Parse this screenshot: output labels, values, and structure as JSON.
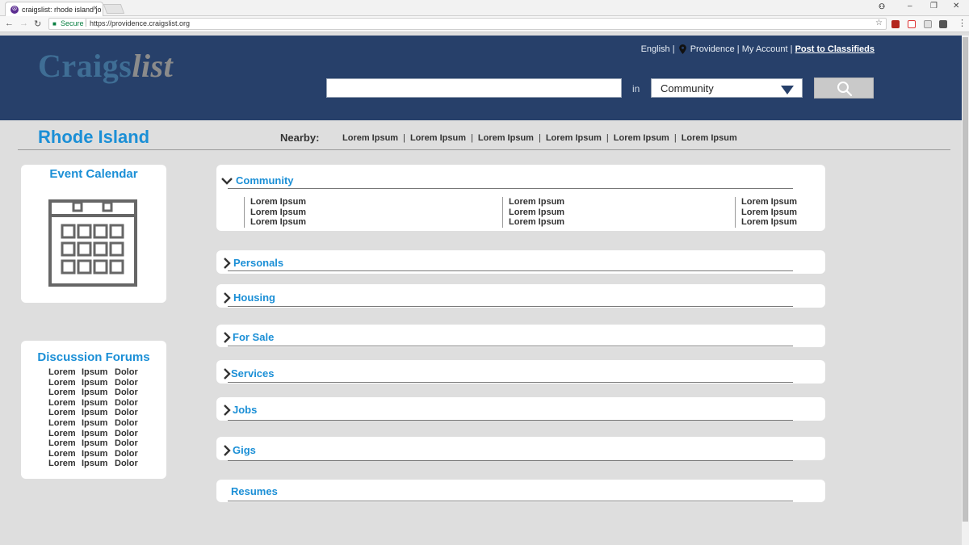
{
  "browser": {
    "tab_title": "craigslist: rhode island jo",
    "secure_label": "Secure",
    "url": "https://providence.craigslist.org"
  },
  "header": {
    "logo_main": "Craigs",
    "logo_accent": "list",
    "lang": "English |",
    "city": "Providence |",
    "account": "My Account |",
    "post": "Post to Classifieds",
    "search_value": "",
    "in_label": "in",
    "category_value": "Community"
  },
  "region": {
    "name": "Rhode Island",
    "nearby_label": "Nearby:",
    "nearby": [
      "Lorem Ipsum",
      "Lorem Ipsum",
      "Lorem Ipsum",
      "Lorem Ipsum",
      "Lorem Ipsum",
      "Lorem Ipsum"
    ]
  },
  "sidebar": {
    "calendar_title": "Event Calendar",
    "forums_title": "Discussion Forums",
    "forum_rows": [
      [
        "Lorem",
        "Ipsum",
        "Dolor"
      ],
      [
        "Lorem",
        "Ipsum",
        "Dolor"
      ],
      [
        "Lorem",
        "Ipsum",
        "Dolor"
      ],
      [
        "Lorem",
        "Ipsum",
        "Dolor"
      ],
      [
        "Lorem",
        "Ipsum",
        "Dolor"
      ],
      [
        "Lorem",
        "Ipsum",
        "Dolor"
      ],
      [
        "Lorem",
        "Ipsum",
        "Dolor"
      ],
      [
        "Lorem",
        "Ipsum",
        "Dolor"
      ],
      [
        "Lorem",
        "Ipsum",
        "Dolor"
      ],
      [
        "Lorem",
        "Ipsum",
        "Dolor"
      ]
    ]
  },
  "categories": [
    {
      "label": "Community",
      "expanded": true,
      "columns": [
        [
          "Lorem Ipsum",
          "Lorem Ipsum",
          "Lorem Ipsum"
        ],
        [
          "Lorem Ipsum",
          "Lorem Ipsum",
          "Lorem Ipsum"
        ],
        [
          "Lorem Ipsum",
          "Lorem Ipsum",
          "Lorem Ipsum"
        ]
      ]
    },
    {
      "label": "Personals"
    },
    {
      "label": "Housing"
    },
    {
      "label": "For Sale"
    },
    {
      "label": "Services"
    },
    {
      "label": "Jobs"
    },
    {
      "label": "Gigs"
    },
    {
      "label": "Resumes"
    }
  ]
}
